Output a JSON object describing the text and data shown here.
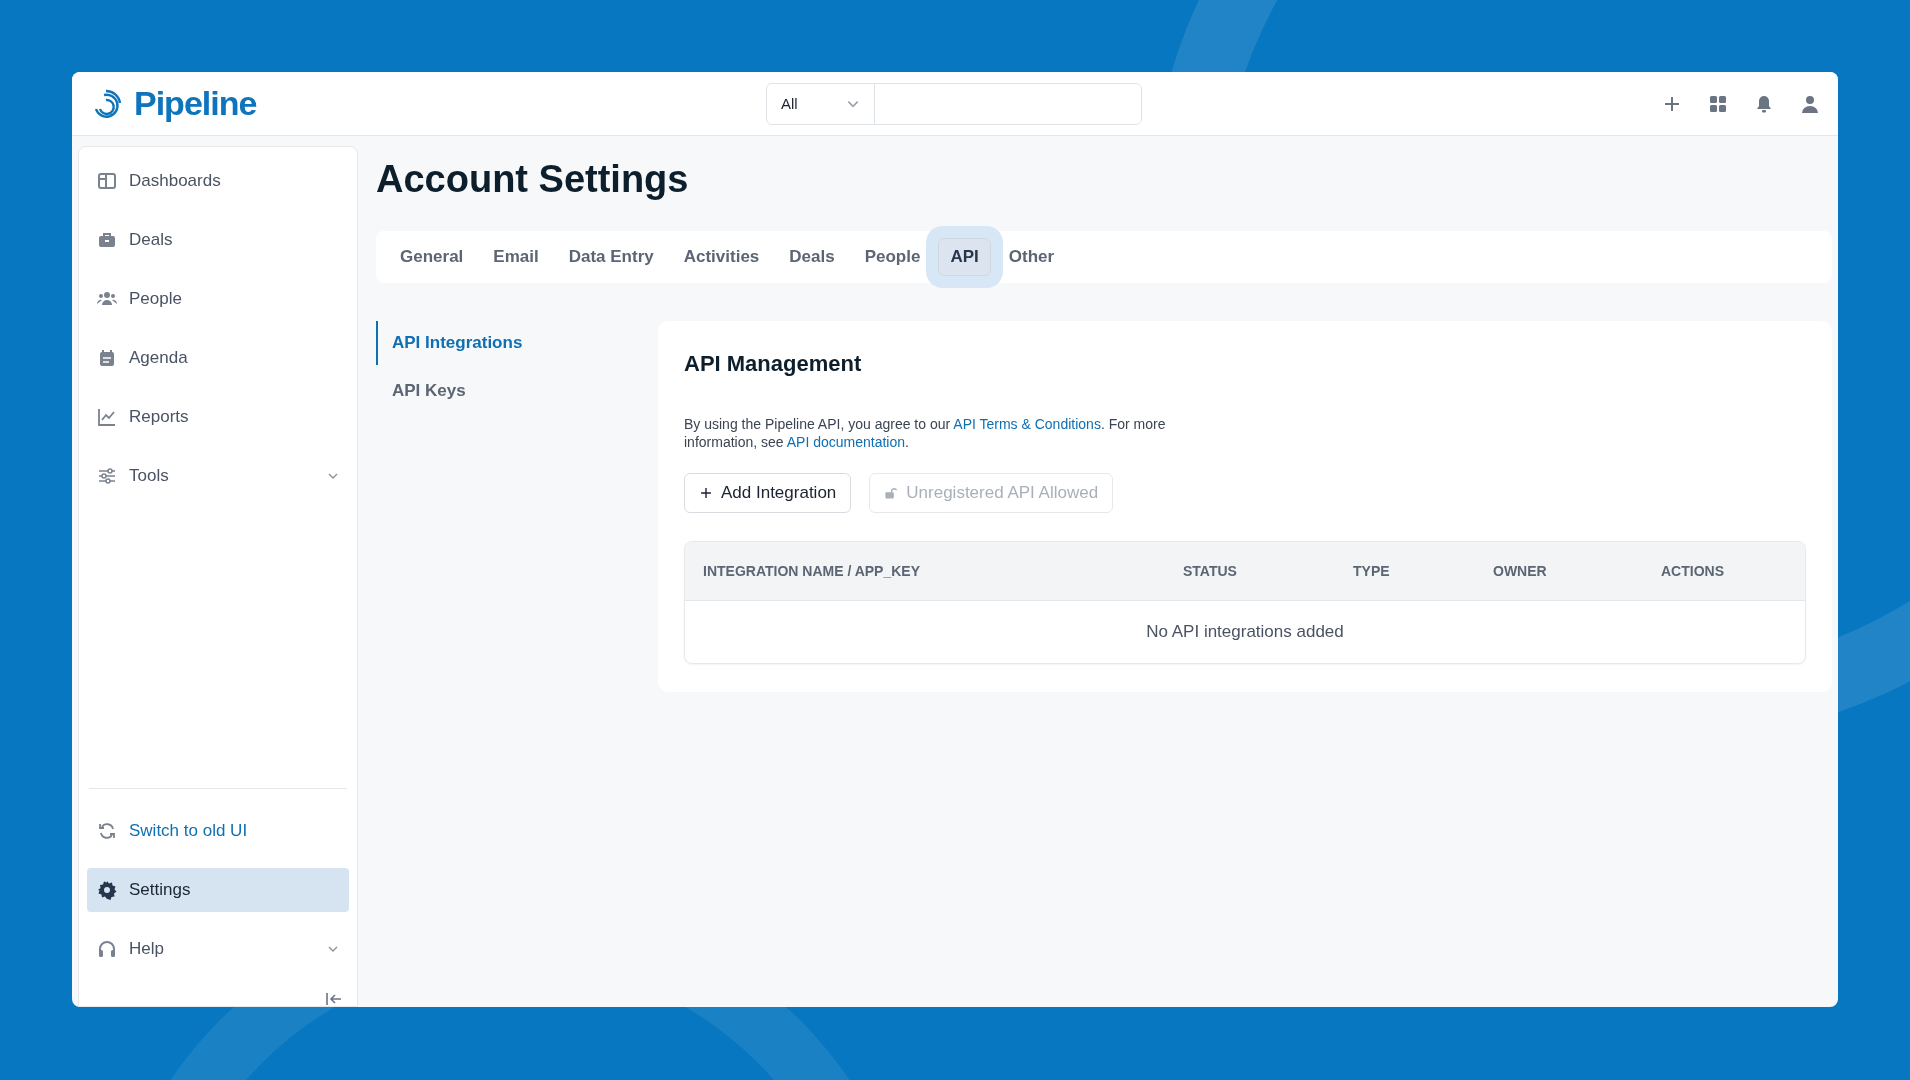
{
  "header": {
    "logo": "Pipeline",
    "search_scope": "All"
  },
  "sidebar": {
    "items": [
      {
        "label": "Dashboards",
        "selected": false
      },
      {
        "label": "Deals",
        "selected": false
      },
      {
        "label": "People",
        "selected": false
      },
      {
        "label": "Agenda",
        "selected": false
      },
      {
        "label": "Reports",
        "selected": false
      },
      {
        "label": "Tools",
        "selected": false,
        "expanded": false
      }
    ],
    "bottom_items": [
      {
        "label": "Switch to old UI",
        "kind": "link",
        "selected": false
      },
      {
        "label": "Settings",
        "kind": "item",
        "selected": true
      },
      {
        "label": "Help",
        "kind": "item",
        "selected": false,
        "expanded": false
      }
    ]
  },
  "page": {
    "title": "Account Settings",
    "tabs": [
      {
        "label": "General",
        "selected": false
      },
      {
        "label": "Email",
        "selected": false
      },
      {
        "label": "Data Entry",
        "selected": false
      },
      {
        "label": "Activities",
        "selected": false
      },
      {
        "label": "Deals",
        "selected": false
      },
      {
        "label": "People",
        "selected": false
      },
      {
        "label": "API",
        "selected": true
      },
      {
        "label": "Other",
        "selected": false
      }
    ],
    "subnav": [
      {
        "label": "API Integrations",
        "selected": true
      },
      {
        "label": "API Keys",
        "selected": false
      }
    ],
    "panel": {
      "title": "API Management",
      "description": [
        {
          "text": "By using the Pipeline API, you agree to our ",
          "link": false
        },
        {
          "text": "API Terms & Conditions",
          "link": true
        },
        {
          "text": ". For more information, see ",
          "link": false
        },
        {
          "text": "API documentation",
          "link": true
        },
        {
          "text": ".",
          "link": false
        }
      ],
      "buttons": [
        {
          "label": "Add Integration",
          "disabled": false
        },
        {
          "label": "Unregistered API Allowed",
          "disabled": true
        }
      ],
      "table": {
        "columns": [
          "INTEGRATION NAME / APP_KEY",
          "STATUS",
          "TYPE",
          "OWNER",
          "ACTIONS"
        ],
        "empty_message": "No API integrations added"
      }
    }
  }
}
